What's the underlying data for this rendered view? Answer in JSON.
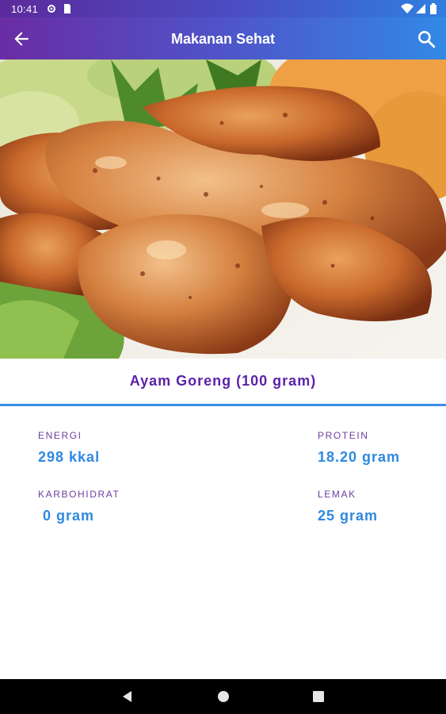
{
  "status_bar": {
    "time": "10:41",
    "icons": [
      "gear-icon",
      "sim-icon",
      "wifi-icon",
      "signal-icon",
      "battery-icon"
    ]
  },
  "app_bar": {
    "title": "Makanan Sehat",
    "back_icon": "arrow-left-icon",
    "search_icon": "search-icon",
    "gradient_colors": [
      "#6a2ca4",
      "#3289e6"
    ]
  },
  "food": {
    "name": "Ayam Goreng (100 gram)",
    "image": "fried-chicken-drumsticks-photo"
  },
  "nutrition": {
    "energi": {
      "label": "ENERGI",
      "value": "298 kkal"
    },
    "protein": {
      "label": "PROTEIN",
      "value": "18.20 gram"
    },
    "karbohidrat": {
      "label": "KARBOHIDRAT",
      "value": " 0 gram"
    },
    "lemak": {
      "label": "LEMAK",
      "value": "25 gram"
    }
  },
  "colors": {
    "title_purple": "#5b22a8",
    "label_purple": "#6b3fa0",
    "value_blue": "#2f88e0",
    "divider_blue": "#3a8ee9"
  },
  "nav_bar": {
    "buttons": [
      "back-triangle-icon",
      "home-circle-icon",
      "recents-square-icon"
    ]
  }
}
